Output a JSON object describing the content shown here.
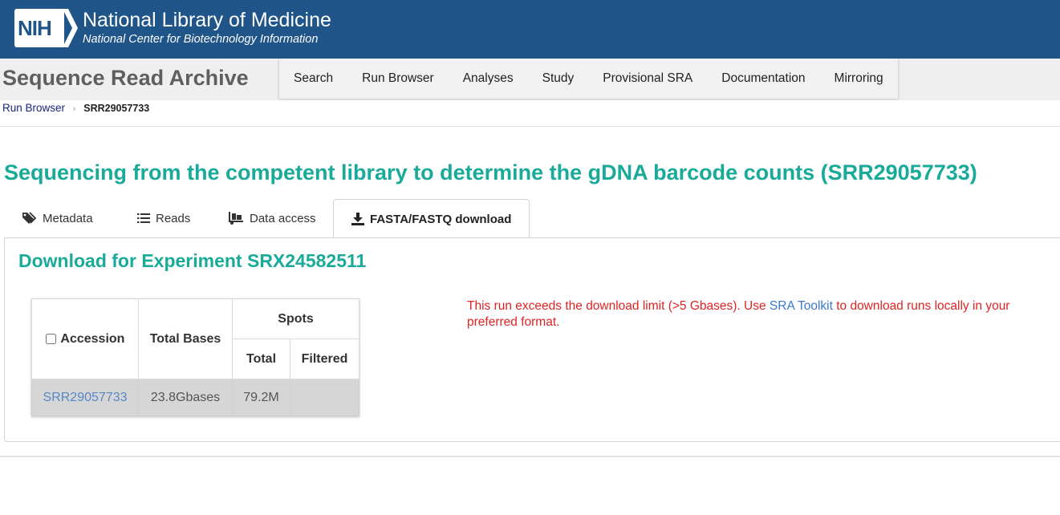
{
  "header": {
    "logo_text": "NIH",
    "title": "National Library of Medicine",
    "subtitle": "National Center for Biotechnology Information",
    "bg_color": "#20558a"
  },
  "app": {
    "title": "Sequence Read Archive",
    "nav": [
      "Search",
      "Run Browser",
      "Analyses",
      "Study",
      "Provisional SRA",
      "Documentation",
      "Mirroring"
    ]
  },
  "breadcrumb": {
    "link": "Run Browser",
    "current": "SRR29057733"
  },
  "page": {
    "title": "Sequencing from the competent library to determine the gDNA barcode counts (SRR29057733)",
    "accent_color": "#1aaa9a"
  },
  "tabs": [
    {
      "label": "Metadata",
      "icon": "tag-icon",
      "active": false
    },
    {
      "label": "Reads",
      "icon": "list-icon",
      "active": false
    },
    {
      "label": "Data access",
      "icon": "truck-icon",
      "active": false
    },
    {
      "label": "FASTA/FASTQ download",
      "icon": "download-icon",
      "active": true
    }
  ],
  "download": {
    "title": "Download for Experiment SRX24582511",
    "table": {
      "headers": {
        "accession": "Accession",
        "total_bases": "Total Bases",
        "spots": "Spots",
        "spots_total": "Total",
        "spots_filtered": "Filtered"
      },
      "rows": [
        {
          "accession": "SRR29057733",
          "total_bases": "23.8Gbases",
          "spots_total": "79.2M",
          "spots_filtered": ""
        }
      ]
    },
    "message": {
      "before": "This run exceeds the download limit (>5 Gbases). Use ",
      "link": "SRA Toolkit",
      "after": " to download runs locally in your preferred format."
    }
  }
}
